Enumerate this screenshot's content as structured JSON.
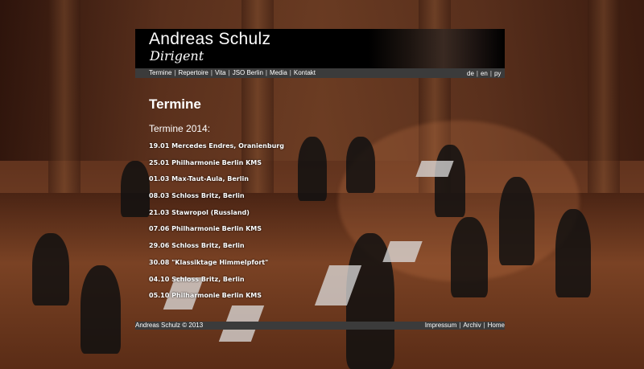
{
  "header": {
    "site_name": "Andreas Schulz",
    "subtitle": "Dirigent"
  },
  "nav": {
    "items": [
      "Termine",
      "Repertoire",
      "Vita",
      "JSO Berlin",
      "Media",
      "Kontakt"
    ]
  },
  "languages": [
    "de",
    "en",
    "ру"
  ],
  "main": {
    "title": "Termine",
    "year_heading": "Termine 2014:",
    "events": [
      "19.01 Mercedes Endres, Oranienburg",
      "25.01 Philharmonie Berlin KMS",
      "01.03 Max-Taut-Aula, Berlin",
      "08.03 Schloss Britz, Berlin",
      "21.03 Stawropol (Russland)",
      "07.06 Philharmonie Berlin KMS",
      "29.06 Schloss Britz, Berlin",
      "30.08 \"Klassiktage Himmelpfort\"",
      "04.10 Schloss Britz, Berlin",
      "05.10 Philharmonie Berlin KMS"
    ]
  },
  "footer": {
    "copyright": "Andreas Schulz © 2013",
    "links": [
      "Impressum",
      "Archiv",
      "Home"
    ]
  },
  "colors": {
    "header_bg": "#000000",
    "nav_bg": "#3b3b3b",
    "text": "#ffffff"
  }
}
